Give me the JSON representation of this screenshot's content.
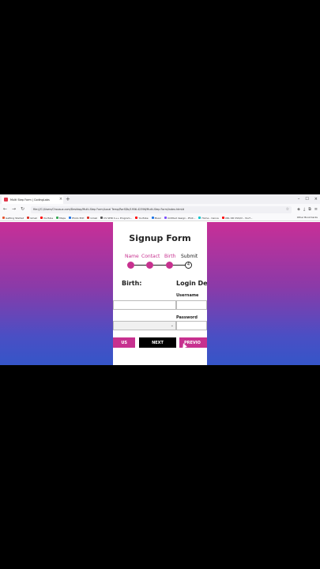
{
  "browser": {
    "tab_title": "Multi Step Form | CodingLabs",
    "tab_close": "×",
    "new_tab": "+",
    "window_controls": {
      "minimize": "–",
      "maximize": "☐",
      "close": "×"
    },
    "url": "file:///C:/Users/Chousux.com/Desktop/Multi-Step Form/Local Temp/RarSDb/1956.42396/Multi-Step Form/index.html#",
    "bookmarks": [
      {
        "label": "Getting Started",
        "color": "#e6522c"
      },
      {
        "label": "Gmail",
        "color": "#d93025"
      },
      {
        "label": "YouTube",
        "color": "#ff0000"
      },
      {
        "label": "Maps",
        "color": "#34a853"
      },
      {
        "label": "Photo Edit",
        "color": "#1a73e8"
      },
      {
        "label": "Gmail",
        "color": "#d93025"
      },
      {
        "label": "CS SPIR C++ Program...",
        "color": "#555555"
      },
      {
        "label": "YouTube",
        "color": "#ff0000"
      },
      {
        "label": "Music",
        "color": "#1a73e8"
      },
      {
        "label": "Untitled design - Phot...",
        "color": "#7c4dff"
      },
      {
        "label": "Home - Canva",
        "color": "#00c4cc"
      },
      {
        "label": "URL OR CSS/CI - YouT...",
        "color": "#ff0000"
      }
    ],
    "other_bookmarks": "Other Bookmarks"
  },
  "form": {
    "title": "Signup Form",
    "steps": [
      {
        "label": "Name",
        "complete": true
      },
      {
        "label": "Contact",
        "complete": true
      },
      {
        "label": "Birth",
        "complete": true
      },
      {
        "label": "Submit",
        "complete": false,
        "number": "4"
      }
    ],
    "birth_section": {
      "title": "Birth:"
    },
    "login_section": {
      "title": "Login De",
      "username_label": "Username",
      "password_label": "Password"
    },
    "buttons": {
      "prev_left": "US",
      "next": "NEXT",
      "prev_right": "PREVIO"
    }
  },
  "colors": {
    "accent": "#c7318f",
    "gradient_top": "#c82f97",
    "gradient_bottom": "#3555c8"
  }
}
